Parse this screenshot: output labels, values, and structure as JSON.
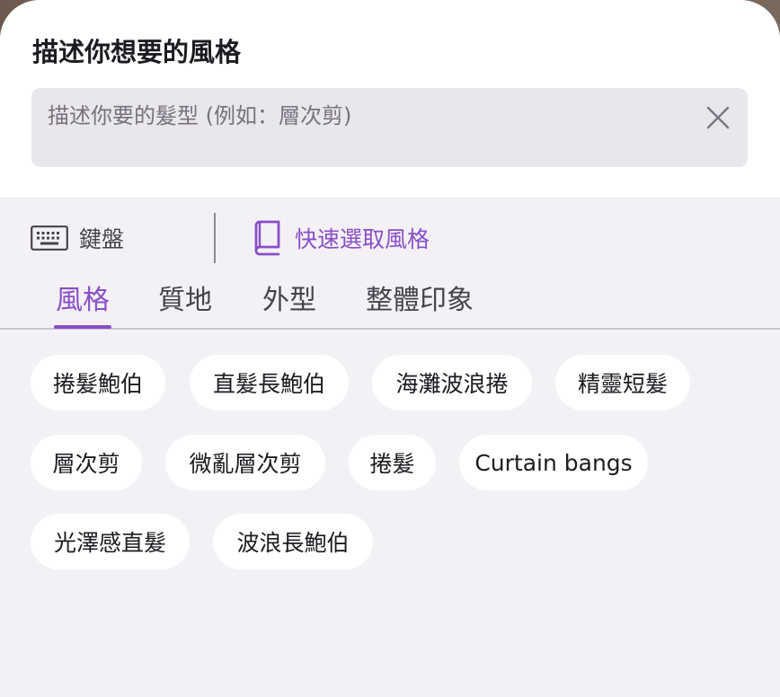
{
  "header": {
    "title": "描述你想要的風格"
  },
  "search": {
    "placeholder": "描述你要的髮型 (例如：層次剪)",
    "value": ""
  },
  "toolbar": {
    "keyboard_label": "鍵盤",
    "quick_select_label": "快速選取風格"
  },
  "tabs": [
    {
      "label": "風格",
      "active": true
    },
    {
      "label": "質地",
      "active": false
    },
    {
      "label": "外型",
      "active": false
    },
    {
      "label": "整體印象",
      "active": false
    }
  ],
  "chips": [
    {
      "label": "捲髮鮑伯"
    },
    {
      "label": "直髮長鮑伯"
    },
    {
      "label": "海灘波浪捲"
    },
    {
      "label": "精靈短髮"
    },
    {
      "label": "層次剪"
    },
    {
      "label": "微亂層次剪"
    },
    {
      "label": "捲髮"
    },
    {
      "label": "Curtain bangs"
    },
    {
      "label": "光澤感直髮"
    },
    {
      "label": "波浪長鮑伯"
    }
  ],
  "colors": {
    "accent": "#8a4fc8",
    "panel_background": "#f3f1f6",
    "search_background": "#e9e6ec",
    "chip_background": "#ffffff"
  },
  "icons": {
    "keyboard": "keyboard-icon",
    "quick_select": "book-icon",
    "clear": "close-icon"
  }
}
